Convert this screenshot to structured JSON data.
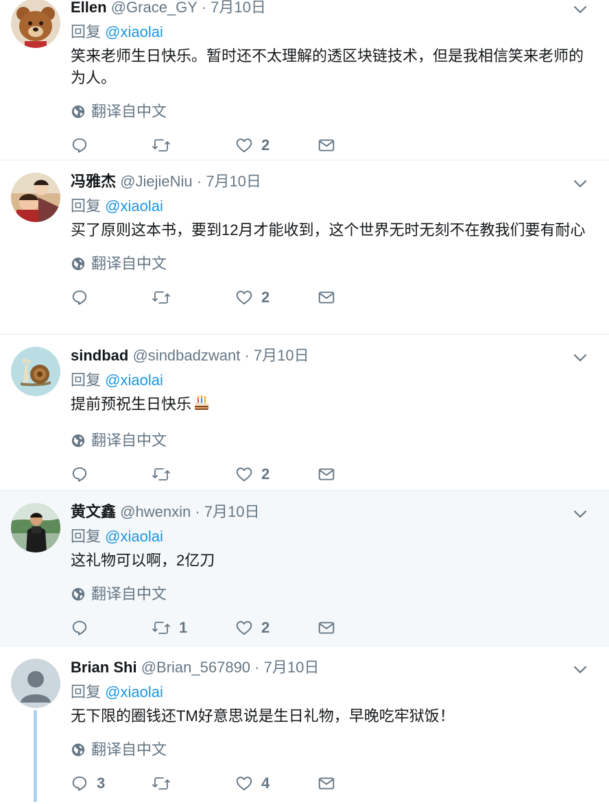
{
  "tweets": [
    {
      "name": "Ellen",
      "handle": "@Grace_GY",
      "dot": "·",
      "date": "7月10日",
      "reply_prefix": "回复 ",
      "mention": "@xiaolai",
      "text": "笑来老师生日快乐。暂时还不太理解的透区块链技术，但是我相信笑来老师的为人。",
      "translate": "翻译自中文",
      "replies": "",
      "retweets": "",
      "likes": "2",
      "avatar_icon": "teddy-bear-avatar"
    },
    {
      "name": "冯雅杰",
      "handle": "@JiejieNiu",
      "dot": "·",
      "date": "7月10日",
      "reply_prefix": "回复 ",
      "mention": "@xiaolai",
      "text": "买了原则这本书，要到12月才能收到，这个世界无时无刻不在教我们要有耐心",
      "translate": "翻译自中文",
      "replies": "",
      "retweets": "",
      "likes": "2",
      "avatar_icon": "photo-avatar"
    },
    {
      "name": "sindbad",
      "handle": "@sindbadzwant",
      "dot": "·",
      "date": "7月10日",
      "reply_prefix": "回复 ",
      "mention": "@xiaolai",
      "text": "提前预祝生日快乐",
      "translate": "翻译自中文",
      "replies": "",
      "retweets": "",
      "likes": "2",
      "avatar_icon": "snail-avatar"
    },
    {
      "name": "黄文鑫",
      "handle": "@hwenxin",
      "dot": "·",
      "date": "7月10日",
      "reply_prefix": "回复 ",
      "mention": "@xiaolai",
      "text": "这礼物可以啊，2亿刀",
      "translate": "翻译自中文",
      "replies": "",
      "retweets": "1",
      "likes": "2",
      "avatar_icon": "person-photo-avatar"
    },
    {
      "name": "Brian Shi",
      "handle": "@Brian_567890",
      "dot": "·",
      "date": "7月10日",
      "reply_prefix": "回复 ",
      "mention": "@xiaolai",
      "text": "无下限的圈钱还TM好意思说是生日礼物，早晚吃牢狱饭！",
      "translate": "翻译自中文",
      "replies": "3",
      "retweets": "",
      "likes": "4",
      "avatar_icon": "default-user-avatar"
    }
  ],
  "colors": {
    "link": "#1b95e0",
    "secondary": "#657786",
    "highlight_bg": "#f5f8fa",
    "thread_line": "#a8d3ef"
  }
}
